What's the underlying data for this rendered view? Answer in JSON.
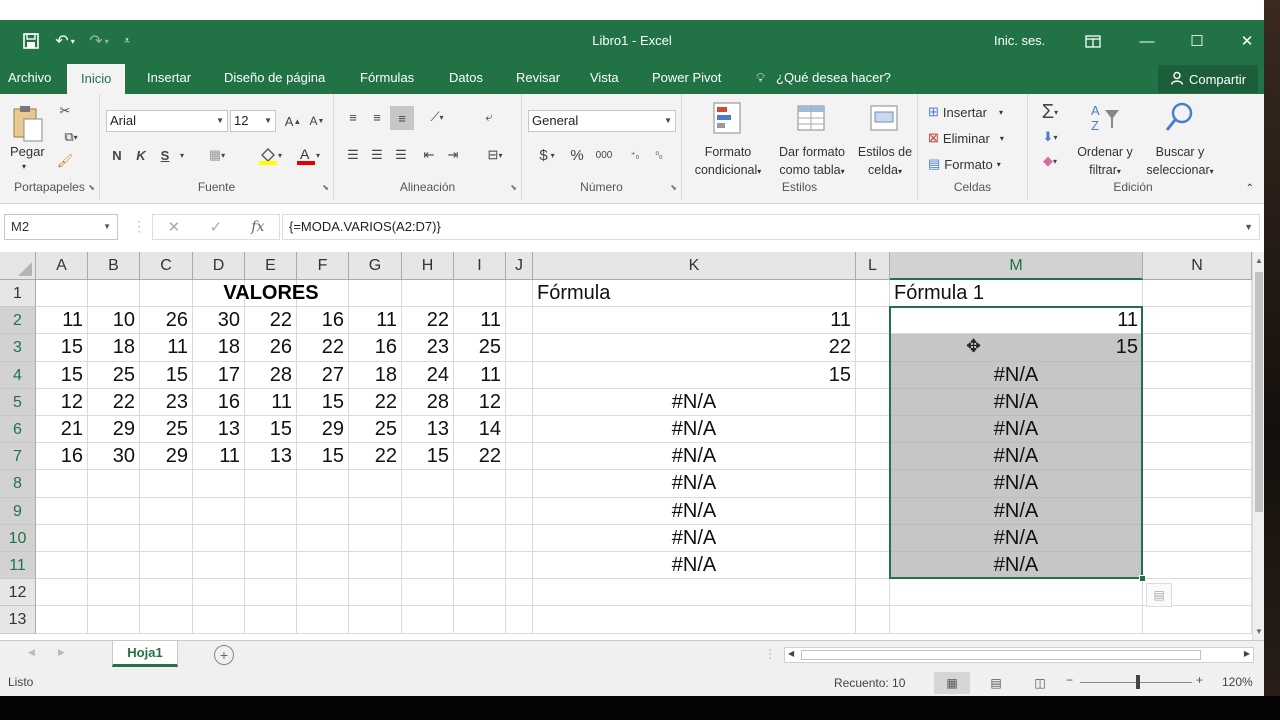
{
  "window": {
    "title": "Libro1  -  Excel",
    "signin": "Inic. ses."
  },
  "tabs": {
    "file": "Archivo",
    "home": "Inicio",
    "insert": "Insertar",
    "layout": "Diseño de página",
    "formulas": "Fórmulas",
    "data": "Datos",
    "review": "Revisar",
    "view": "Vista",
    "powerpivot": "Power Pivot",
    "tellme": "¿Qué desea hacer?",
    "share": "Compartir"
  },
  "ribbon": {
    "clipboard": {
      "label": "Portapapeles",
      "paste": "Pegar"
    },
    "font": {
      "label": "Fuente",
      "name": "Arial",
      "size": "12",
      "bold": "N",
      "italic": "K",
      "underline": "S"
    },
    "alignment": {
      "label": "Alineación"
    },
    "number": {
      "label": "Número",
      "format": "General",
      "currency": "$",
      "percent": "%",
      "thousands": "000"
    },
    "styles": {
      "label": "Estilos",
      "cond1": "Formato",
      "cond2": "condicional",
      "table1": "Dar formato",
      "table2": "como tabla",
      "cell1": "Estilos de",
      "cell2": "celda"
    },
    "cells": {
      "label": "Celdas",
      "insert": "Insertar",
      "delete": "Eliminar",
      "format": "Formato"
    },
    "editing": {
      "label": "Edición",
      "sort1": "Ordenar y",
      "sort2": "filtrar",
      "find1": "Buscar y",
      "find2": "seleccionar"
    }
  },
  "formula_bar": {
    "name_box": "M2",
    "formula": "{=MODA.VARIOS(A2:D7)}",
    "fx": "fx"
  },
  "columns": [
    "A",
    "B",
    "C",
    "D",
    "E",
    "F",
    "G",
    "H",
    "I",
    "J",
    "K",
    "L",
    "M",
    "N"
  ],
  "rows": [
    "1",
    "2",
    "3",
    "4",
    "5",
    "6",
    "7",
    "8",
    "9",
    "10",
    "11",
    "12",
    "13"
  ],
  "sheet": {
    "valores_title": "VALORES",
    "formula_header": "Fórmula",
    "formula1_header": "Fórmula 1",
    "values": [
      [
        "11",
        "10",
        "26",
        "30",
        "22",
        "16",
        "11",
        "22",
        "11"
      ],
      [
        "15",
        "18",
        "11",
        "18",
        "26",
        "22",
        "16",
        "23",
        "25"
      ],
      [
        "15",
        "25",
        "15",
        "17",
        "28",
        "27",
        "18",
        "24",
        "11"
      ],
      [
        "12",
        "22",
        "23",
        "16",
        "11",
        "15",
        "22",
        "28",
        "12"
      ],
      [
        "21",
        "29",
        "25",
        "13",
        "15",
        "29",
        "25",
        "13",
        "14"
      ],
      [
        "16",
        "30",
        "29",
        "11",
        "13",
        "15",
        "22",
        "15",
        "22"
      ]
    ],
    "col_k": [
      "11",
      "22",
      "15",
      "#N/A",
      "#N/A",
      "#N/A",
      "#N/A",
      "#N/A",
      "#N/A",
      "#N/A"
    ],
    "col_m": [
      "11",
      "15",
      "#N/A",
      "#N/A",
      "#N/A",
      "#N/A",
      "#N/A",
      "#N/A",
      "#N/A",
      "#N/A"
    ]
  },
  "sheet_tabs": {
    "active": "Hoja1"
  },
  "status": {
    "ready": "Listo",
    "count": "Recuento: 10",
    "zoom": "120%"
  }
}
